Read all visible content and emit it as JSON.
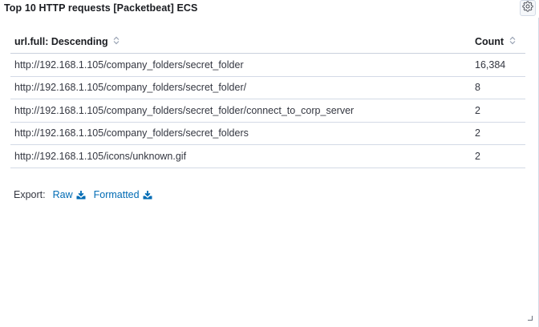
{
  "panel": {
    "title": "Top 10 HTTP requests [Packetbeat] ECS",
    "options_icon": "gear-icon"
  },
  "table": {
    "columns": [
      {
        "label": "url.full: Descending",
        "sort_icon": "sort-icon"
      },
      {
        "label": "Count",
        "sort_icon": "sort-icon"
      }
    ],
    "rows": [
      {
        "url": "http://192.168.1.105/company_folders/secret_folder",
        "count": "16,384"
      },
      {
        "url": "http://192.168.1.105/company_folders/secret_folder/",
        "count": "8"
      },
      {
        "url": "http://192.168.1.105/company_folders/secret_folder/connect_to_corp_server",
        "count": "2"
      },
      {
        "url": "http://192.168.1.105/company_folders/secret_folders",
        "count": "2"
      },
      {
        "url": "http://192.168.1.105/icons/unknown.gif",
        "count": "2"
      }
    ]
  },
  "export": {
    "label": "Export:",
    "raw_label": "Raw",
    "formatted_label": "Formatted",
    "icon": "download-icon"
  },
  "colors": {
    "link": "#006bb4",
    "text": "#343741",
    "heading": "#1a1c21",
    "border": "#d3dae6"
  }
}
